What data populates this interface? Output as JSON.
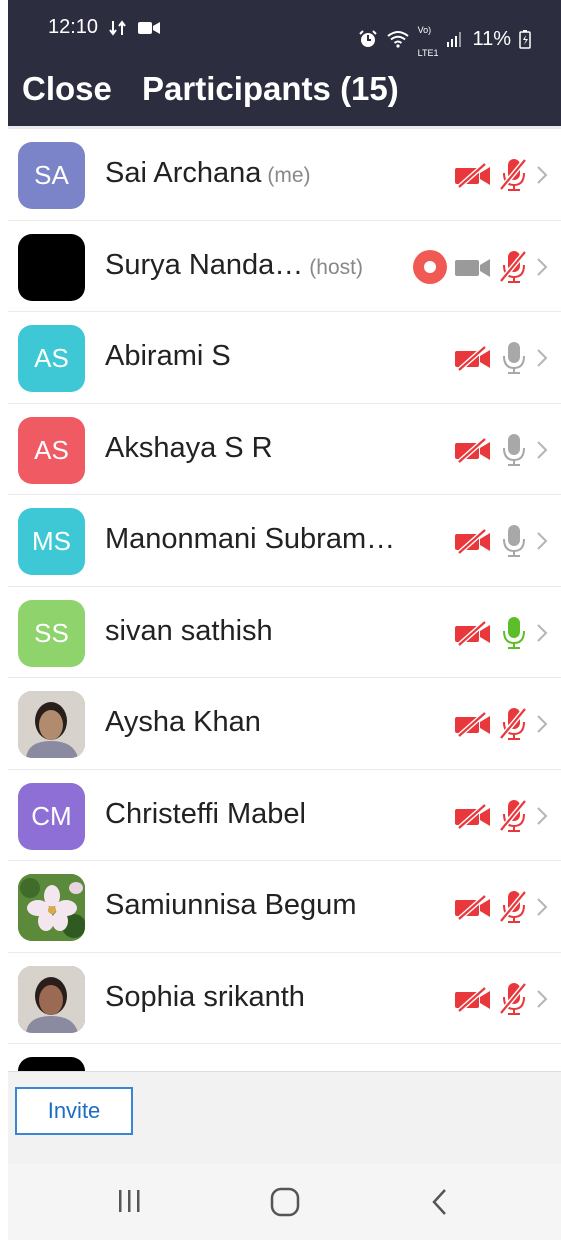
{
  "status": {
    "time": "12:10",
    "battery": "11%",
    "volte_top": "Vo)",
    "volte_bottom": "LTE1"
  },
  "header": {
    "close_label": "Close",
    "title": "Participants (15)"
  },
  "colors": {
    "header_bg": "#2c2e3f",
    "muted_red": "#e8383c",
    "mic_green": "#5cbf2a",
    "accent_blue": "#1e6cc4"
  },
  "participants": [
    {
      "initials": "SA",
      "name": "Sai Archana",
      "tag": "(me)",
      "avatar_color": "#7b84c9",
      "video": "off",
      "audio": "muted"
    },
    {
      "initials": "",
      "name": "Surya Nanda…",
      "tag": "(host)",
      "avatar_color": "#000000",
      "recording": true,
      "video": "on",
      "audio": "muted"
    },
    {
      "initials": "AS",
      "name": "Abirami S",
      "tag": "",
      "avatar_color": "#3ec8d6",
      "video": "off",
      "audio": "on"
    },
    {
      "initials": "AS",
      "name": "Akshaya S R",
      "tag": "",
      "avatar_color": "#f05a63",
      "video": "off",
      "audio": "on"
    },
    {
      "initials": "MS",
      "name": "Manonmani Subram…",
      "tag": "",
      "avatar_color": "#3ec8d6",
      "video": "off",
      "audio": "on"
    },
    {
      "initials": "SS",
      "name": "sivan sathish",
      "tag": "",
      "avatar_color": "#8fd36d",
      "video": "off",
      "audio": "speaking"
    },
    {
      "initials": "",
      "name": "Aysha Khan",
      "tag": "",
      "avatar_color": "#b08b6e",
      "avatar_type": "photo-person",
      "video": "off",
      "audio": "muted"
    },
    {
      "initials": "CM",
      "name": "Christeffi Mabel",
      "tag": "",
      "avatar_color": "#8d6fd6",
      "video": "off",
      "audio": "muted"
    },
    {
      "initials": "",
      "name": "Samiunnisa Begum",
      "tag": "",
      "avatar_color": "#5a8a3a",
      "avatar_type": "photo-flower",
      "video": "off",
      "audio": "muted"
    },
    {
      "initials": "",
      "name": "Sophia srikanth",
      "tag": "",
      "avatar_color": "#9b6a52",
      "avatar_type": "photo-person",
      "video": "off",
      "audio": "muted"
    }
  ],
  "footer": {
    "invite_label": "Invite"
  }
}
